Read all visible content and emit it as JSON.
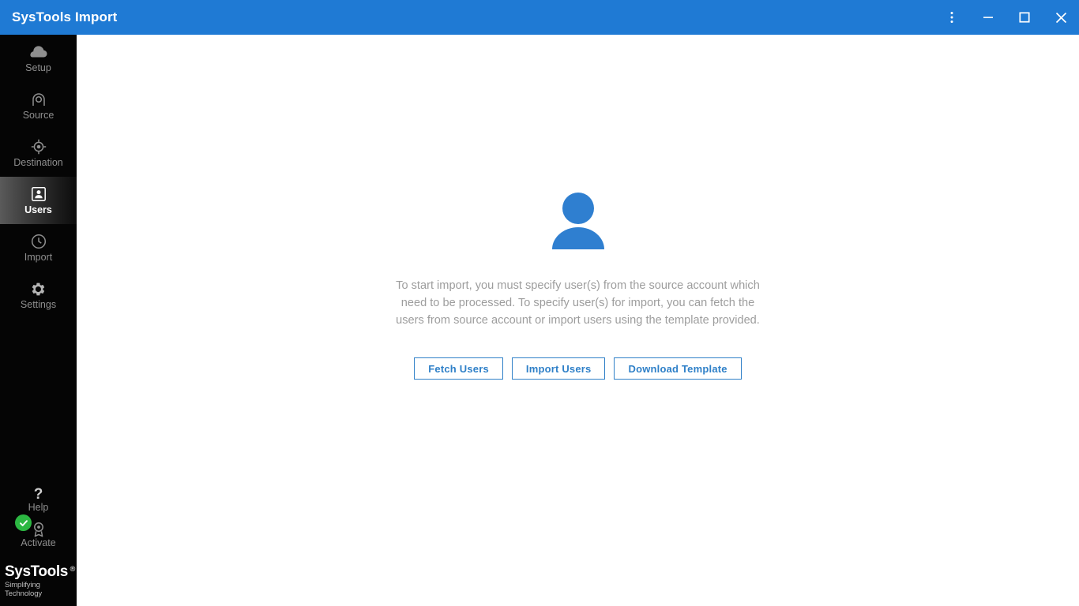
{
  "window": {
    "title": "SysTools Import",
    "accent_color": "#1f7ad4",
    "controls": [
      {
        "name": "more-options-button",
        "icon": "kebab-menu-icon"
      },
      {
        "name": "minimize-button",
        "icon": "minimize-icon"
      },
      {
        "name": "maximize-button",
        "icon": "maximize-icon"
      },
      {
        "name": "close-button",
        "icon": "close-icon"
      }
    ]
  },
  "sidebar": {
    "background_color": "#050505",
    "items": [
      {
        "label": "Setup",
        "icon": "cloud-icon",
        "active": false
      },
      {
        "label": "Source",
        "icon": "source-arch-icon",
        "active": false
      },
      {
        "label": "Destination",
        "icon": "target-crosshair-icon",
        "active": false
      },
      {
        "label": "Users",
        "icon": "user-badge-icon",
        "active": true
      },
      {
        "label": "Import",
        "icon": "clock-icon",
        "active": false
      },
      {
        "label": "Settings",
        "icon": "gear-icon",
        "active": false
      }
    ],
    "bottom": {
      "help_label": "Help",
      "help_icon": "question-mark-icon",
      "activate_label": "Activate",
      "activate_icon": "award-badge-icon",
      "activate_status_icon": "green-check-icon",
      "activate_status_color": "#2cb742"
    },
    "logo": {
      "name": "SysTools",
      "registered_mark": "®",
      "tagline": "Simplifying Technology"
    }
  },
  "main": {
    "illustration_icon": "user-avatar-illustration",
    "illustration_color": "#2f7fd0",
    "description": "To start import, you must specify user(s) from the source account which need to be processed. To specify user(s) for import, you can fetch the users from source account or import users using the template provided.",
    "buttons": [
      {
        "label": "Fetch Users",
        "name": "fetch-users-button"
      },
      {
        "label": "Import Users",
        "name": "import-users-button"
      },
      {
        "label": "Download Template",
        "name": "download-template-button"
      }
    ],
    "button_color": "#2f80c8"
  }
}
